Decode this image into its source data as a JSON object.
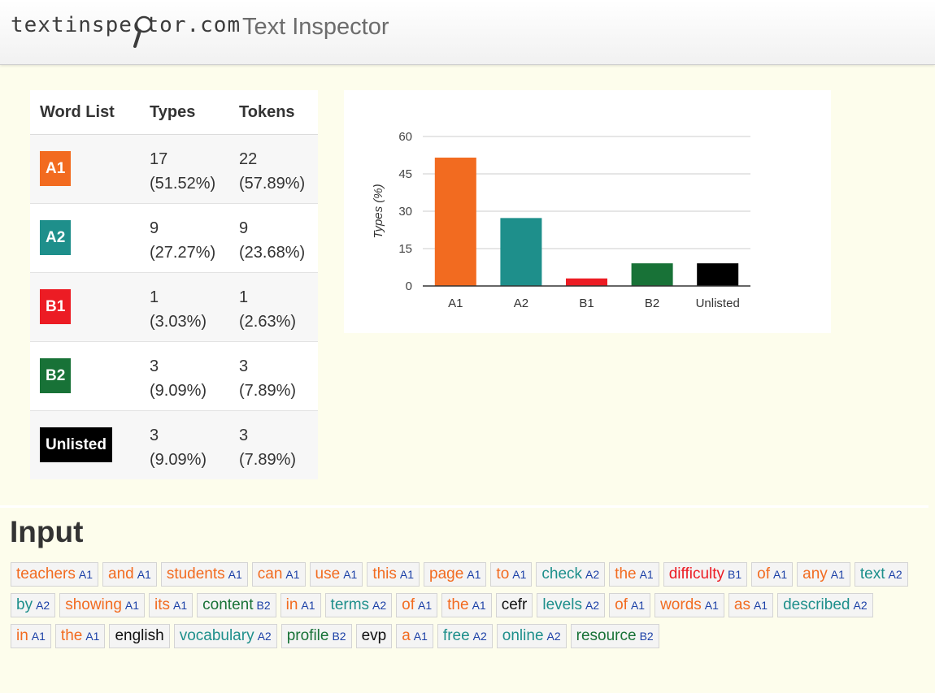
{
  "header": {
    "logo_text": "textinspector.com",
    "app_title": "Text Inspector"
  },
  "colors": {
    "A1": "#f26b20",
    "A2": "#1e8f8b",
    "B1": "#ec1c24",
    "B2": "#187237",
    "Unlisted": "#000000"
  },
  "word_table": {
    "headers": {
      "list": "Word List",
      "types": "Types",
      "tokens": "Tokens"
    },
    "rows": [
      {
        "level": "A1",
        "types": "17",
        "types_pct": "(51.52%)",
        "tokens": "22",
        "tokens_pct": "(57.89%)"
      },
      {
        "level": "A2",
        "types": "9",
        "types_pct": "(27.27%)",
        "tokens": "9",
        "tokens_pct": "(23.68%)"
      },
      {
        "level": "B1",
        "types": "1",
        "types_pct": "(3.03%)",
        "tokens": "1",
        "tokens_pct": "(2.63%)"
      },
      {
        "level": "B2",
        "types": "3",
        "types_pct": "(9.09%)",
        "tokens": "3",
        "tokens_pct": "(7.89%)"
      },
      {
        "level": "Unlisted",
        "types": "3",
        "types_pct": "(9.09%)",
        "tokens": "3",
        "tokens_pct": "(7.89%)"
      }
    ]
  },
  "chart_data": {
    "type": "bar",
    "categories": [
      "A1",
      "A2",
      "B1",
      "B2",
      "Unlisted"
    ],
    "values": [
      51.52,
      27.27,
      3.03,
      9.09,
      9.09
    ],
    "bar_colors": [
      "#f26b20",
      "#1e8f8b",
      "#ec1c24",
      "#187237",
      "#000000"
    ],
    "ylabel": "Types (%)",
    "xlabel": "",
    "ylim": [
      0,
      60
    ],
    "yticks": [
      "0",
      "15",
      "30",
      "45",
      "60"
    ],
    "grid": true
  },
  "input": {
    "title": "Input",
    "tokens": [
      {
        "word": "teachers",
        "level": "A1"
      },
      {
        "word": "and",
        "level": "A1"
      },
      {
        "word": "students",
        "level": "A1"
      },
      {
        "word": "can",
        "level": "A1"
      },
      {
        "word": "use",
        "level": "A1"
      },
      {
        "word": "this",
        "level": "A1"
      },
      {
        "word": "page",
        "level": "A1"
      },
      {
        "word": "to",
        "level": "A1"
      },
      {
        "word": "check",
        "level": "A2"
      },
      {
        "word": "the",
        "level": "A1"
      },
      {
        "word": "difficulty",
        "level": "B1"
      },
      {
        "word": "of",
        "level": "A1"
      },
      {
        "word": "any",
        "level": "A1"
      },
      {
        "word": "text",
        "level": "A2"
      },
      {
        "word": "by",
        "level": "A2"
      },
      {
        "word": "showing",
        "level": "A1"
      },
      {
        "word": "its",
        "level": "A1"
      },
      {
        "word": "content",
        "level": "B2"
      },
      {
        "word": "in",
        "level": "A1"
      },
      {
        "word": "terms",
        "level": "A2"
      },
      {
        "word": "of",
        "level": "A1"
      },
      {
        "word": "the",
        "level": "A1"
      },
      {
        "word": "cefr",
        "level": ""
      },
      {
        "word": "levels",
        "level": "A2"
      },
      {
        "word": "of",
        "level": "A1"
      },
      {
        "word": "words",
        "level": "A1"
      },
      {
        "word": "as",
        "level": "A1"
      },
      {
        "word": "described",
        "level": "A2"
      },
      {
        "word": "in",
        "level": "A1"
      },
      {
        "word": "the",
        "level": "A1"
      },
      {
        "word": "english",
        "level": ""
      },
      {
        "word": "vocabulary",
        "level": "A2"
      },
      {
        "word": "profile",
        "level": "B2"
      },
      {
        "word": "evp",
        "level": ""
      },
      {
        "word": "a",
        "level": "A1"
      },
      {
        "word": "free",
        "level": "A2"
      },
      {
        "word": "online",
        "level": "A2"
      },
      {
        "word": "resource",
        "level": "B2"
      }
    ]
  }
}
